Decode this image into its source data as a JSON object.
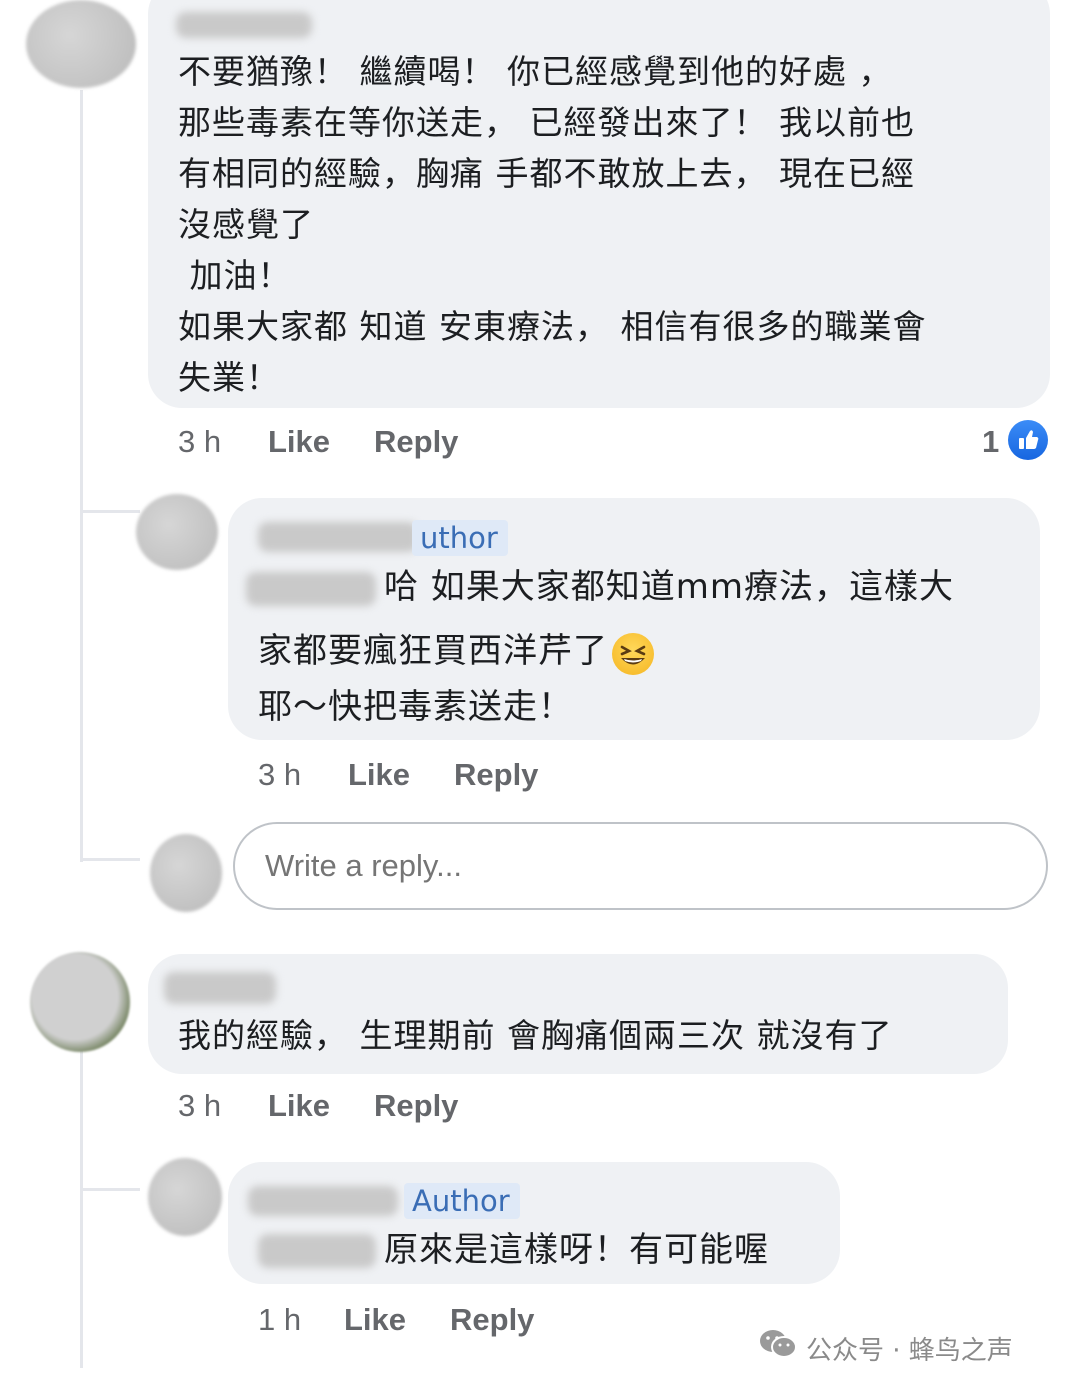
{
  "comments": [
    {
      "text_lines": [
        "不要猶豫！ 繼續喝！ 你已經感覺到他的好處 ，",
        "那些毒素在等你送走， 已經發出來了！ 我以前也",
        "有相同的經驗，胸痛 手都不敢放上去， 現在已經",
        "沒感覺了",
        " 加油！",
        "如果大家都 知道 安東療法， 相信有很多的職業會",
        "失業！"
      ],
      "time": "3 h",
      "like_label": "Like",
      "reply_label": "Reply",
      "like_count": "1",
      "replies": [
        {
          "badge": "Author",
          "badge_visible": "uthor",
          "text_lines": [
            "哈 如果大家都知道mm療法，這樣大",
            "家都要瘋狂買西洋芹了",
            "耶～快把毒素送走！"
          ],
          "emoji": "grinning-squinting-face",
          "time": "3 h",
          "like_label": "Like",
          "reply_label": "Reply"
        }
      ],
      "reply_input_placeholder": "Write a reply..."
    },
    {
      "text_lines": [
        "我的經驗， 生理期前 會胸痛個兩三次 就沒有了"
      ],
      "time": "3 h",
      "like_label": "Like",
      "reply_label": "Reply",
      "replies": [
        {
          "badge": "Author",
          "text_lines": [
            "原來是這樣呀！有可能喔"
          ],
          "time": "1 h",
          "like_label": "Like",
          "reply_label": "Reply"
        }
      ]
    }
  ],
  "watermark": {
    "icon": "wechat-icon",
    "text": "公众号 · 蜂鸟之声"
  },
  "colors": {
    "bubble": "#eff1f4",
    "author_badge_bg": "#dfe9f7",
    "author_badge_text": "#3a6db5",
    "like_icon": "#1877f2",
    "meta_text": "#65676b"
  }
}
